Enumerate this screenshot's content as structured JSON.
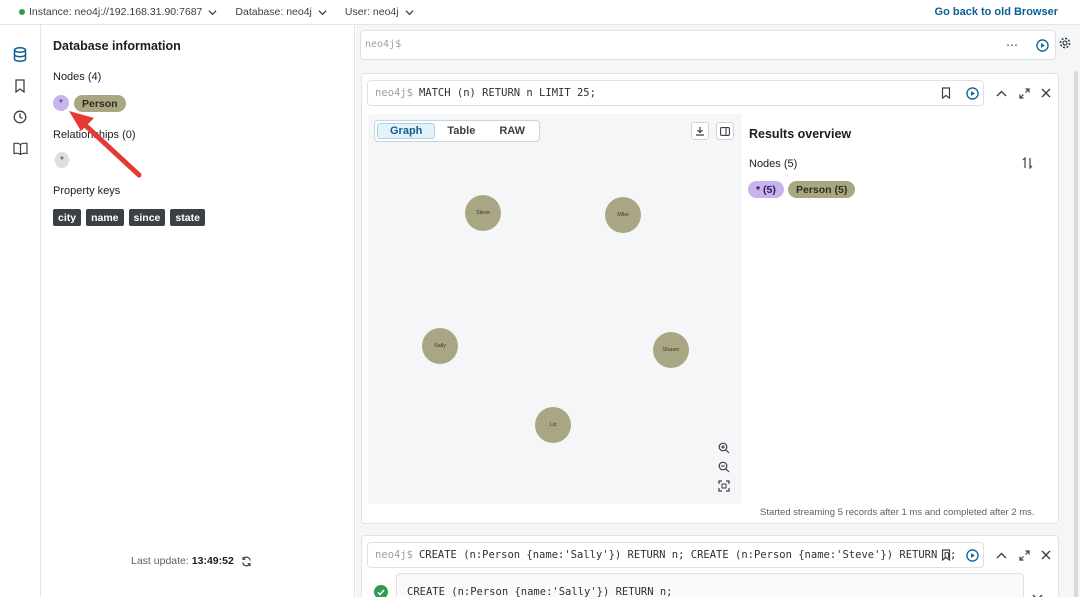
{
  "topbar": {
    "instance": "Instance: neo4j://192.168.31.90:7687",
    "database": "Database: neo4j",
    "user": "User: neo4j",
    "back_link": "Go back to old Browser"
  },
  "rail": {
    "items": [
      {
        "icon": "database-icon",
        "active": true
      },
      {
        "icon": "bookmark-icon",
        "active": false
      },
      {
        "icon": "history-icon",
        "active": false
      },
      {
        "icon": "book-icon",
        "active": false
      }
    ]
  },
  "db_panel": {
    "title": "Database information",
    "nodes_title": "Nodes (4)",
    "node_labels": [
      "*",
      "Person"
    ],
    "relationships_title": "Relationships (0)",
    "relationship_types": [
      "*"
    ],
    "property_keys_title": "Property keys",
    "property_keys": [
      "city",
      "name",
      "since",
      "state"
    ],
    "last_update_label": "Last update:",
    "last_update_time": "13:49:52"
  },
  "editor": {
    "placeholder": "neo4j$"
  },
  "frame1": {
    "prompt": "neo4j$",
    "query": "MATCH (n) RETURN n LIMIT 25;",
    "tabs": [
      "Graph",
      "Table",
      "RAW"
    ],
    "active_tab": "Graph",
    "nodes": [
      "Steve",
      "Mike",
      "Sally",
      "Shawn",
      "Liz"
    ],
    "results_title": "Results overview",
    "results_nodes_title": "Nodes (5)",
    "results_chips": [
      "* (5)",
      "Person (5)"
    ],
    "status": "Started streaming 5 records after 1 ms and completed after 2 ms."
  },
  "frame2": {
    "prompt": "neo4j$",
    "query": "CREATE (n:Person {name:'Sally'}) RETURN n; CREATE (n:Person {name:'Steve'}) RETURN n;",
    "result_query": "CREATE (n:Person {name:'Sally'}) RETURN n;"
  },
  "colors": {
    "accent": "#0a5f95",
    "person_label": "#a9a783",
    "star_label": "#c9b2f0",
    "success": "#2e9d4f",
    "annotation_arrow": "#e53935"
  }
}
